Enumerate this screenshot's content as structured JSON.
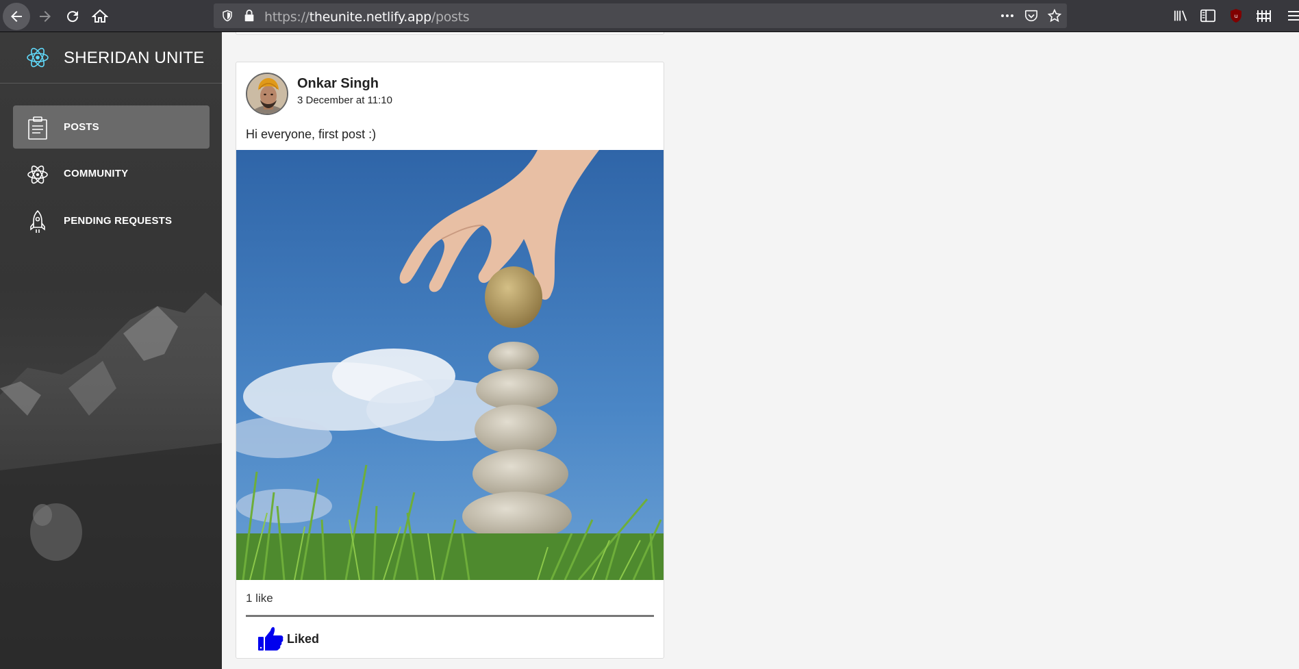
{
  "browser": {
    "url_scheme": "https://",
    "url_host": "theunite.netlify.app",
    "url_path": "/posts"
  },
  "app": {
    "title": "SHERIDAN UNITE"
  },
  "sidebar": {
    "items": [
      {
        "label": "POSTS",
        "icon": "clipboard-icon",
        "active": true
      },
      {
        "label": "COMMUNITY",
        "icon": "atom-icon",
        "active": false
      },
      {
        "label": "PENDING REQUESTS",
        "icon": "rocket-icon",
        "active": false
      }
    ]
  },
  "post": {
    "author": "Onkar Singh",
    "timestamp": "3 December at 11:10",
    "text": "Hi everyone, first post :)",
    "likes": "1 like",
    "like_button_label": "Liked",
    "like_color": "#0000ee"
  },
  "colors": {
    "accent": "#61dafb",
    "toolbar": "#38383d",
    "sidebar": "#3a3a3a"
  }
}
